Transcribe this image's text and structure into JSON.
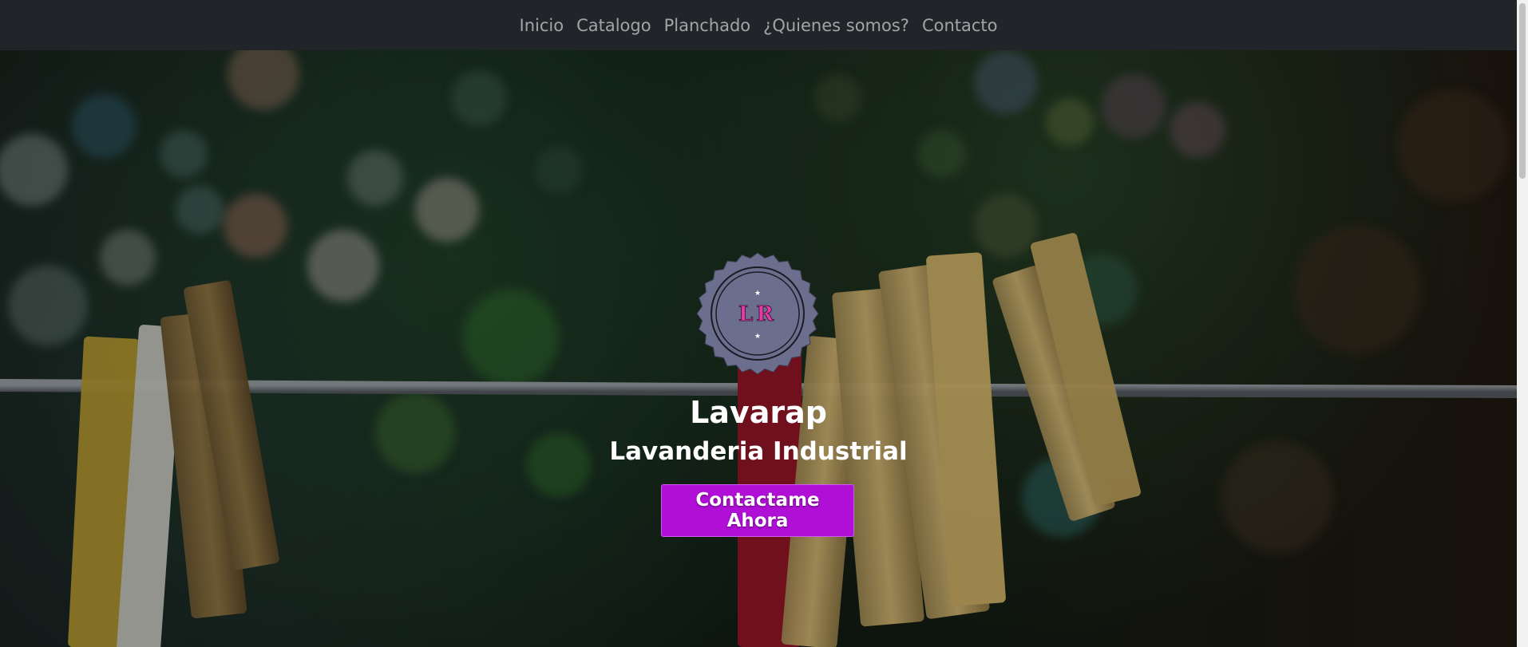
{
  "nav": {
    "items": [
      {
        "label": "Inicio"
      },
      {
        "label": "Catalogo"
      },
      {
        "label": "Planchado"
      },
      {
        "label": "¿Quienes somos?"
      },
      {
        "label": "Contacto"
      }
    ]
  },
  "hero": {
    "logo": {
      "letters": "LR",
      "star": "★",
      "colors": {
        "badge": "#6b6e8c",
        "letters": "#e63aa6"
      }
    },
    "title": "Lavarap",
    "subtitle": "Lavanderia Industrial",
    "cta_label": "Contactame Ahora",
    "colors": {
      "cta": "#b00fd6",
      "navbar": "#212529"
    }
  }
}
